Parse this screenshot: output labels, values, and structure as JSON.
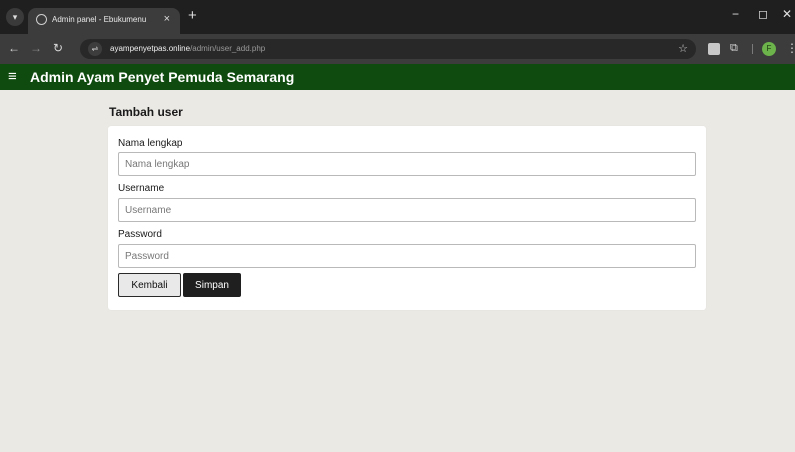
{
  "browser": {
    "tab_title": "Admin panel - Ebukumenu",
    "tab_close": "×",
    "new_tab": "+",
    "url_domain": "ayampenyetpas.online",
    "url_path": "/admin/user_add.php",
    "minimize": "−",
    "maximize": "◻",
    "close_window": "✕",
    "profile_initial": "F"
  },
  "app": {
    "menu_icon": "≡",
    "title": "Admin Ayam Penyet Pemuda Semarang"
  },
  "page": {
    "heading": "Tambah user"
  },
  "form": {
    "fullname": {
      "label": "Nama lengkap",
      "placeholder": "Nama lengkap",
      "value": ""
    },
    "username": {
      "label": "Username",
      "placeholder": "Username",
      "value": ""
    },
    "password": {
      "label": "Password",
      "placeholder": "Password",
      "value": ""
    },
    "back_label": "Kembali",
    "save_label": "Simpan"
  },
  "colors": {
    "appbar": "#0f4a0f",
    "background": "#ebe9e4",
    "save_button": "#1f1f1f"
  },
  "icons": [
    "tab-search-icon",
    "globe-icon",
    "back-arrow-icon",
    "forward-arrow-icon",
    "reload-icon",
    "site-settings-icon",
    "star-icon",
    "extension-icon",
    "puzzle-icon",
    "kebab-menu-icon",
    "hamburger-icon"
  ]
}
